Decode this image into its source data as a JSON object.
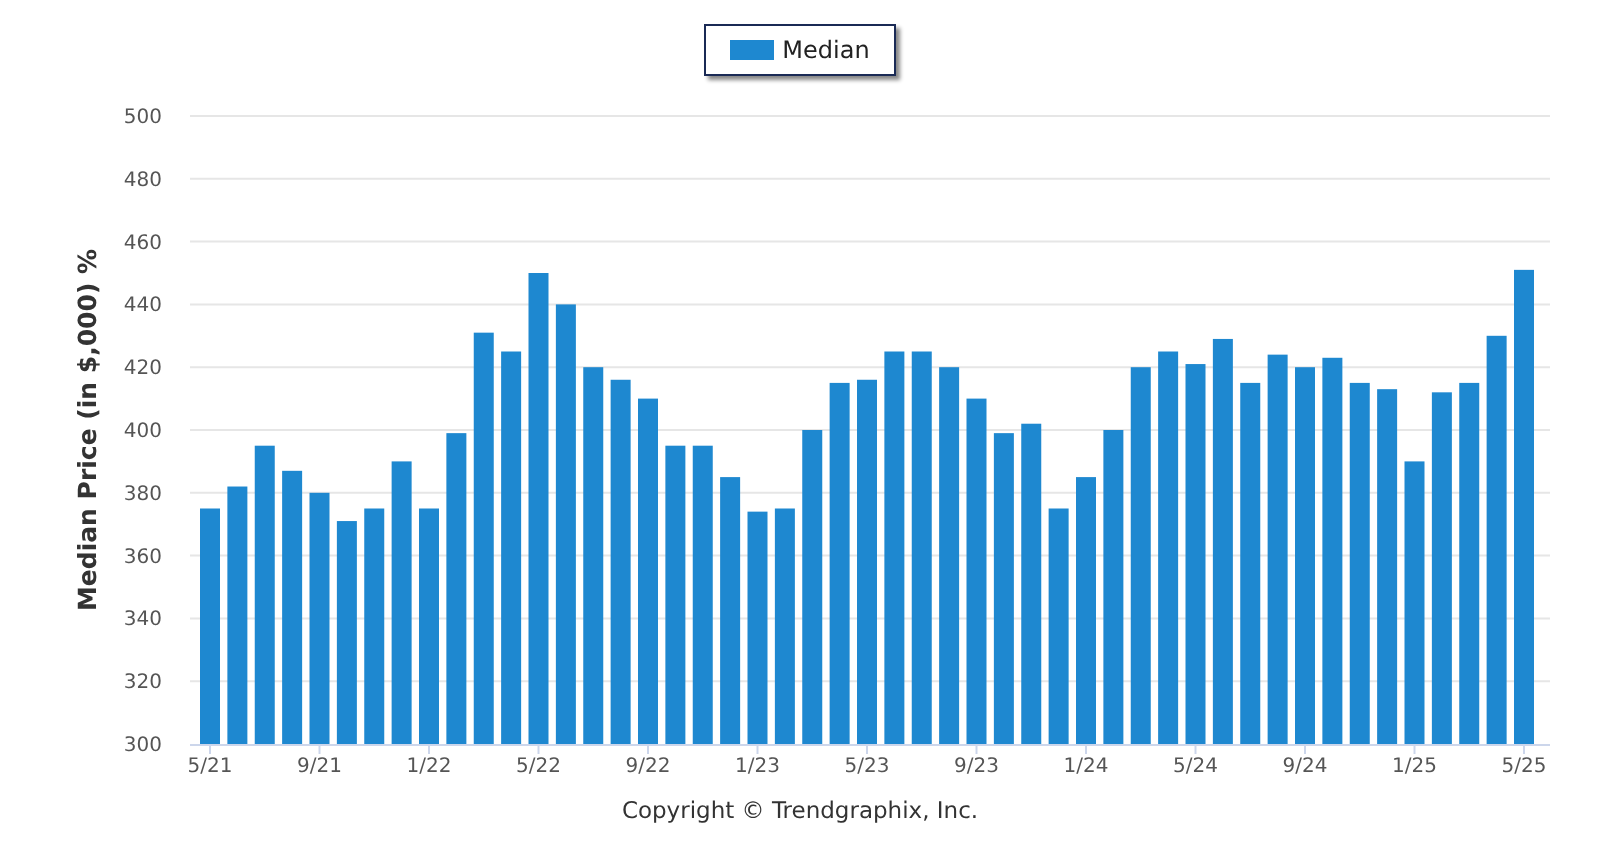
{
  "chart_data": {
    "type": "bar",
    "ylabel": "Median Price (in $,000) %",
    "ylim": [
      300,
      500
    ],
    "yticks": [
      300,
      320,
      340,
      360,
      380,
      400,
      420,
      440,
      460,
      480,
      500
    ],
    "grid": true,
    "categories": [
      "5/21",
      null,
      null,
      null,
      "9/21",
      null,
      null,
      null,
      "1/22",
      null,
      null,
      null,
      "5/22",
      null,
      null,
      null,
      "9/22",
      null,
      null,
      null,
      "1/23",
      null,
      null,
      null,
      "5/23",
      null,
      null,
      null,
      "9/23",
      null,
      null,
      null,
      "1/24",
      null,
      null,
      null,
      "5/24",
      null,
      null,
      null,
      "9/24",
      null,
      null,
      null,
      "1/25",
      null,
      null,
      null,
      "5/25"
    ],
    "series": [
      {
        "name": "Median",
        "color": "#1e88d0",
        "values": [
          375,
          382,
          395,
          387,
          380,
          371,
          375,
          390,
          375,
          399,
          431,
          425,
          450,
          440,
          420,
          416,
          410,
          395,
          395,
          385,
          374,
          375,
          400,
          415,
          416,
          425,
          425,
          420,
          410,
          399,
          402,
          375,
          385,
          400,
          420,
          425,
          421,
          429,
          415,
          424,
          420,
          423,
          415,
          413,
          390,
          412,
          415,
          430,
          451
        ]
      }
    ]
  },
  "copyright": "Copyright © Trendgraphix, Inc."
}
